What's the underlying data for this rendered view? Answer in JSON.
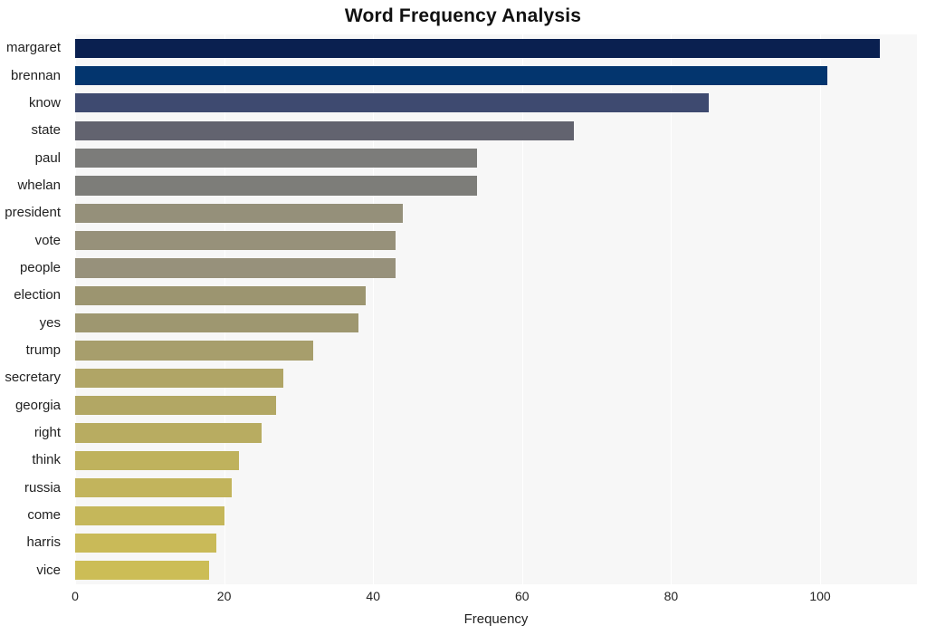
{
  "chart_data": {
    "type": "bar",
    "orientation": "horizontal",
    "title": "Word Frequency Analysis",
    "xlabel": "Frequency",
    "ylabel": "",
    "xlim": [
      0,
      113
    ],
    "xticks": [
      0,
      20,
      40,
      60,
      80,
      100
    ],
    "grid": true,
    "legend": "none",
    "categories": [
      "margaret",
      "brennan",
      "know",
      "state",
      "paul",
      "whelan",
      "president",
      "vote",
      "people",
      "election",
      "yes",
      "trump",
      "secretary",
      "georgia",
      "right",
      "think",
      "russia",
      "come",
      "harris",
      "vice"
    ],
    "values": [
      108,
      101,
      85,
      67,
      54,
      54,
      44,
      43,
      43,
      39,
      38,
      32,
      28,
      27,
      25,
      22,
      21,
      20,
      19,
      18
    ],
    "bar_colors": [
      "#0a2050",
      "#03356e",
      "#3e4a70",
      "#62636f",
      "#7c7c7a",
      "#7d7d79",
      "#95907a",
      "#97917a",
      "#97917b",
      "#9c9570",
      "#9e9770",
      "#a79e6c",
      "#b0a566",
      "#b2a764",
      "#b8ac61",
      "#bfb25d",
      "#c2b45c",
      "#c5b75a",
      "#c9ba58",
      "#ccbd56"
    ]
  },
  "style": {
    "plot_background": "#f7f7f7",
    "figure_background": "#ffffff",
    "gridline_color": "#ffffff",
    "text_color": "#222222",
    "title_color": "#111111"
  }
}
